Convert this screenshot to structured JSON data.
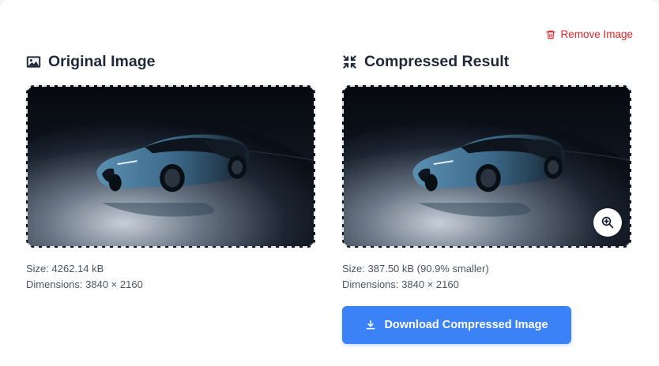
{
  "actions": {
    "remove_label": "Remove Image",
    "download_label": "Download Compressed Image"
  },
  "original": {
    "title": "Original Image",
    "size": "Size: 4262.14 kB",
    "dimensions": "Dimensions: 3840 × 2160"
  },
  "compressed": {
    "title": "Compressed Result",
    "size": "Size: 387.50 kB (90.9% smaller)",
    "dimensions": "Dimensions: 3840 × 2160"
  },
  "icons": {
    "remove": "trash-icon",
    "original": "image-icon",
    "compressed": "compress-icon",
    "zoom": "zoom-in-icon",
    "download": "download-icon"
  },
  "colors": {
    "accent": "#3b82f6",
    "danger": "#dc2626",
    "heading": "#1f2937",
    "muted": "#4b5563"
  }
}
